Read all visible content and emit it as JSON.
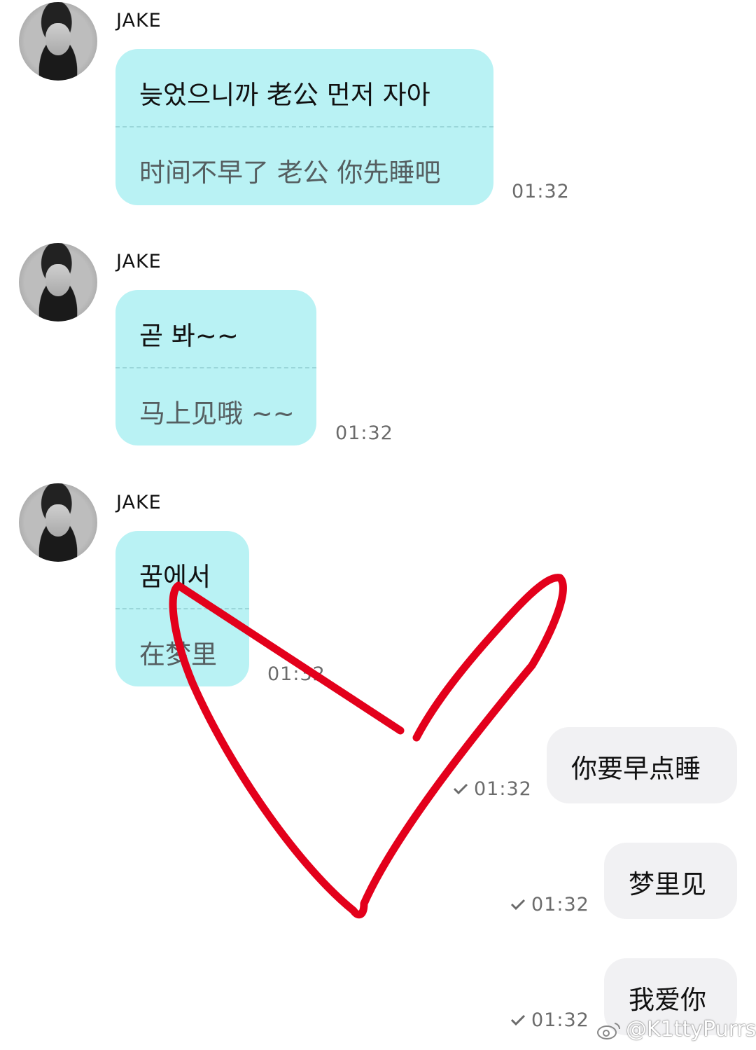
{
  "messages_in": [
    {
      "sender": "JAKE",
      "original": "늦었으니까 老公 먼저 자아",
      "translation": "时间不早了 老公 你先睡吧",
      "time": "01:32"
    },
    {
      "sender": "JAKE",
      "original": "곧 봐~~",
      "translation": "马上见哦 ~~",
      "time": "01:32"
    },
    {
      "sender": "JAKE",
      "original": "꿈에서",
      "translation": "在梦里",
      "time": "01:32"
    }
  ],
  "messages_out": [
    {
      "text": "你要早点睡",
      "time": "01:32",
      "status_icon": "check-icon"
    },
    {
      "text": "梦里见",
      "time": "01:32",
      "status_icon": "check-icon"
    },
    {
      "text": "我爱你",
      "time": "01:32",
      "status_icon": "check-icon"
    }
  ],
  "annotation": {
    "color": "#e3001b",
    "shape": "heart-drawing"
  },
  "watermark": {
    "text": "@K1ttyPurrs",
    "icon": "weibo-icon"
  },
  "colors": {
    "incoming_bubble": "#b9f2f4",
    "outgoing_bubble": "#f1f1f3",
    "background": "#ffffff"
  }
}
